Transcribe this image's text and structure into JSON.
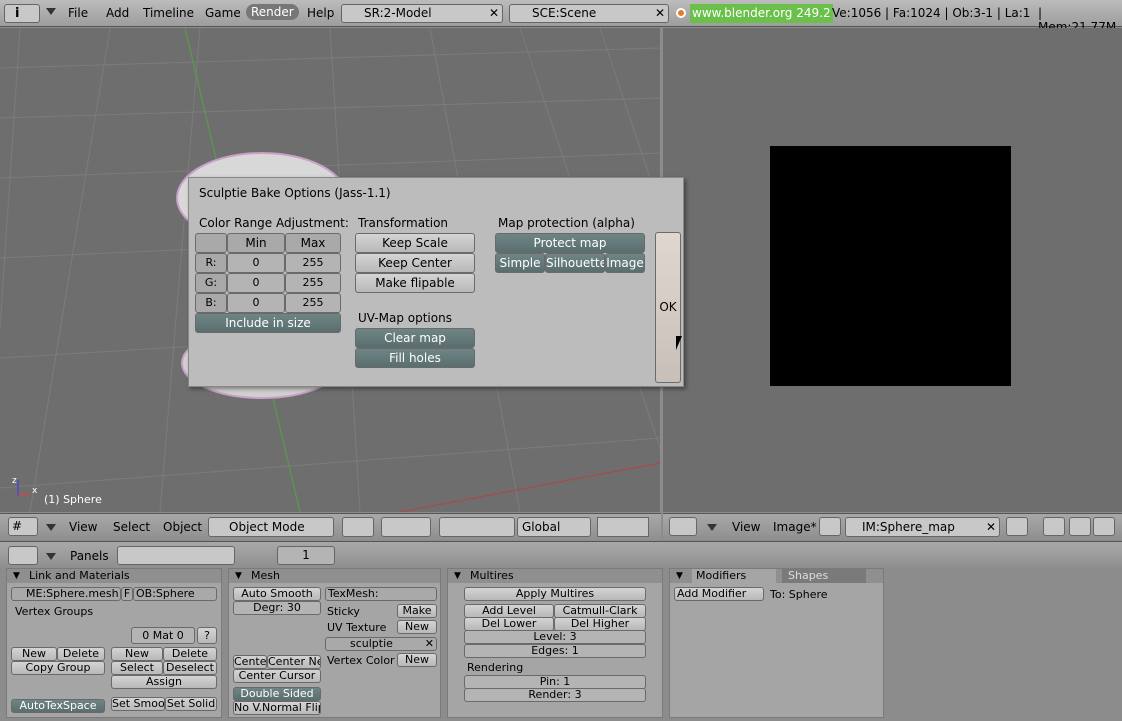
{
  "topbar": {
    "menus": [
      "File",
      "Add",
      "Timeline",
      "Game",
      "Render",
      "Help"
    ],
    "screen_field": "SR:2-Model",
    "scene_field": "SCE:Scene",
    "url": "www.blender.org 249.2",
    "stats": "Ve:1056 | Fa:1024 | Ob:3-1 | La:1",
    "mem": "| Mem:21.77M ("
  },
  "viewport3d": {
    "object_label": "(1) Sphere",
    "axis_x": "x",
    "axis_z": "z",
    "header": {
      "view": "View",
      "select": "Select",
      "object": "Object",
      "mode": "Object Mode",
      "orientation": "Global"
    }
  },
  "image_editor": {
    "header": {
      "view": "View",
      "image": "Image*",
      "image_name": "IM:Sphere_map"
    }
  },
  "dialog": {
    "title": "Sculptie Bake Options (Jass-1.1)",
    "color_range": {
      "heading": "Color Range Adjustment:",
      "col_min": "Min",
      "col_max": "Max",
      "rows": [
        {
          "label": "R:",
          "min": "0",
          "max": "255"
        },
        {
          "label": "G:",
          "min": "0",
          "max": "255"
        },
        {
          "label": "B:",
          "min": "0",
          "max": "255"
        }
      ],
      "include_in_size": "Include in size"
    },
    "transformation": {
      "heading": "Transformation",
      "keep_scale": "Keep Scale",
      "keep_center": "Keep Center",
      "make_flipable": "Make flipable"
    },
    "uvmap": {
      "heading": "UV-Map options",
      "clear_map": "Clear map",
      "fill_holes": "Fill holes"
    },
    "map_protection": {
      "heading": "Map protection (alpha)",
      "protect_map": "Protect map",
      "simple": "Simple",
      "silhouette": "Silhouette",
      "image": "Image"
    },
    "ok": "OK"
  },
  "buttons_window": {
    "panels_label": "Panels",
    "frame": "1",
    "link_materials": {
      "title": "Link and Materials",
      "mesh": "ME:Sphere.mesh",
      "f": "F",
      "ob": "OB:Sphere",
      "vertex_groups": "Vertex Groups",
      "mat": "0 Mat 0",
      "q": "?",
      "new1": "New",
      "delete1": "Delete",
      "copy_group": "Copy Group",
      "new2": "New",
      "delete2": "Delete",
      "select": "Select",
      "deselect": "Deselect",
      "assign": "Assign",
      "autotexspace": "AutoTexSpace",
      "set_smoot": "Set Smoot",
      "set_solid": "Set Solid"
    },
    "mesh": {
      "title": "Mesh",
      "auto_smooth": "Auto Smooth",
      "degr": "Degr: 30",
      "texmesh": "TexMesh:",
      "sticky": "Sticky",
      "make": "Make",
      "uv_texture": "UV Texture",
      "new_uv": "New",
      "sculptie": "sculptie",
      "vertex_color": "Vertex Color",
      "new_vc": "New",
      "cente": "Cente",
      "center_ne": "Center Ne",
      "center_cursor": "Center Cursor",
      "double_sided": "Double Sided",
      "no_vnormal_flip": "No V.Normal Flip"
    },
    "multires": {
      "title": "Multires",
      "apply": "Apply Multires",
      "add_level": "Add Level",
      "catmull": "Catmull-Clark",
      "del_lower": "Del Lower",
      "del_higher": "Del Higher",
      "level": "Level: 3",
      "edges": "Edges: 1",
      "rendering": "Rendering",
      "pin": "Pin: 1",
      "render": "Render: 3"
    },
    "modifiers": {
      "tab_modifiers": "Modifiers",
      "tab_shapes": "Shapes",
      "add_modifier": "Add Modifier",
      "to": "To: Sphere"
    }
  }
}
